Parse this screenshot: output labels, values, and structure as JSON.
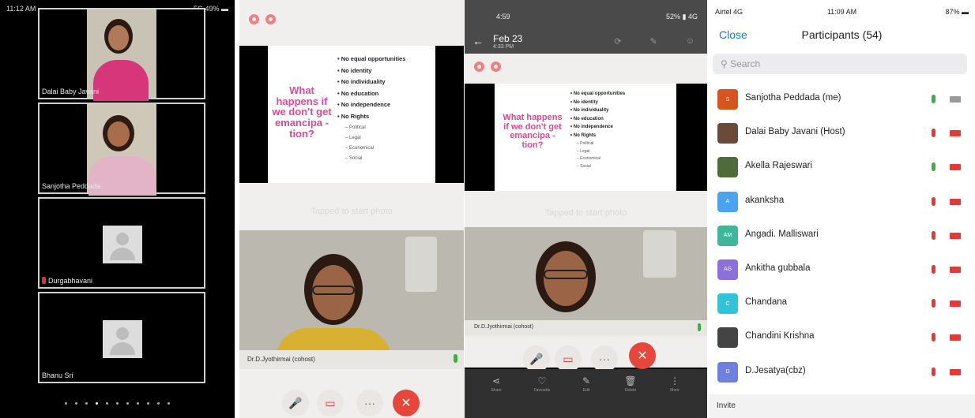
{
  "panel1": {
    "status_time": "11:12 AM",
    "status_right": "5G 49% ▬",
    "tiles": [
      {
        "name": "Dalai Baby Javani"
      },
      {
        "name": "Sanjotha Peddada"
      },
      {
        "name": "Durgabhavani"
      },
      {
        "name": "Bhanu Sri"
      }
    ]
  },
  "slide": {
    "question": "What happens if we don't get emancipa -tion?",
    "bullets": [
      "No equal opportunities",
      "No identity",
      "No individuality",
      "No education",
      "No independence",
      "No Rights"
    ],
    "sub_bullets": [
      "Political",
      "Legal",
      "Economical",
      "Social"
    ]
  },
  "panel2": {
    "tap_text": "Tapped to start photo",
    "speaker_label": "Dr.D.Jyothirmai (cohost)",
    "controls": {
      "mic_icon": "mic-muted-icon",
      "video_icon": "video-off-icon",
      "more_label": "···",
      "end_label": "✕"
    }
  },
  "panel3": {
    "status_time": "4:59",
    "status_right": "52% ▮ 4G",
    "date": "Feb 23",
    "date_sub": "4:33 PM",
    "tap_text": "Tapped to start photo",
    "speaker_label": "Dr.D.Jyothirmai (cohost)",
    "nav": [
      {
        "icon": "⋖",
        "label": "Share"
      },
      {
        "icon": "♡",
        "label": "Favourite"
      },
      {
        "icon": "✎",
        "label": "Edit"
      },
      {
        "icon": "🗑",
        "label": "Delete"
      },
      {
        "icon": "⋮",
        "label": "More"
      }
    ]
  },
  "panel4": {
    "carrier": "Airtel 4G",
    "time": "11:09 AM",
    "battery": "87% ▬",
    "close_label": "Close",
    "title": "Participants (54)",
    "search_placeholder": "Search",
    "invite_label": "Invite",
    "participants": [
      {
        "name": "Sanjotha Peddada (me)",
        "initials": "S",
        "color": "#d9531e",
        "mic": "#3cb043",
        "cam": "#999999"
      },
      {
        "name": "Dalai Baby Javani (Host)",
        "initials": "",
        "color": "#6b4a3a",
        "mic": "#e53935",
        "cam": "#e53935"
      },
      {
        "name": "Akella Rajeswari",
        "initials": "",
        "color": "#4e6b3a",
        "mic": "#3cb043",
        "cam": "#e53935"
      },
      {
        "name": "akanksha",
        "initials": "A",
        "color": "#4aa3f0",
        "mic": "#e53935",
        "cam": "#e53935"
      },
      {
        "name": "Angadi. Malliswari",
        "initials": "AM",
        "color": "#3fb59a",
        "mic": "#e53935",
        "cam": "#e53935"
      },
      {
        "name": "Ankitha gubbala",
        "initials": "AG",
        "color": "#8c6fd8",
        "mic": "#e53935",
        "cam": "#e53935"
      },
      {
        "name": "Chandana",
        "initials": "C",
        "color": "#33c3d8",
        "mic": "#e53935",
        "cam": "#e53935"
      },
      {
        "name": "Chandini Krishna",
        "initials": "",
        "color": "#444444",
        "mic": "#e53935",
        "cam": "#e53935"
      },
      {
        "name": "D.Jesatya(cbz)",
        "initials": "D",
        "color": "#6f7fe0",
        "mic": "#e53935",
        "cam": "#e53935"
      }
    ]
  }
}
